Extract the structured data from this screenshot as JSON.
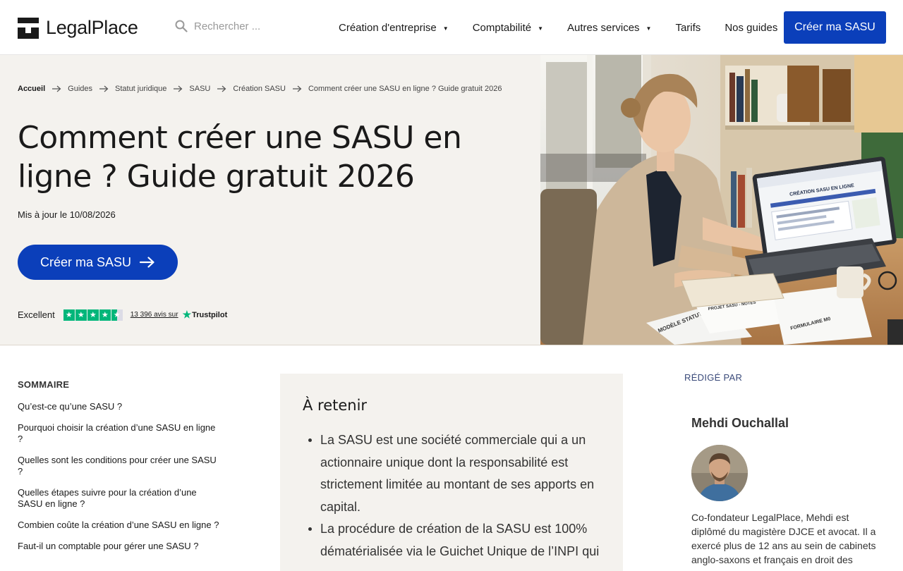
{
  "header": {
    "logo_text": "LegalPlace",
    "search_placeholder": "Rechercher ...",
    "nav": [
      {
        "label": "Création d'entreprise",
        "has_dropdown": true
      },
      {
        "label": "Comptabilité",
        "has_dropdown": true
      },
      {
        "label": "Autres services",
        "has_dropdown": true
      },
      {
        "label": "Tarifs",
        "has_dropdown": false
      },
      {
        "label": "Nos guides",
        "has_dropdown": true
      }
    ],
    "cta_label": "Créer ma SASU"
  },
  "hero": {
    "breadcrumb": [
      "Accueil",
      "Guides",
      "Statut juridique",
      "SASU",
      "Création SASU",
      "Comment créer une SASU en ligne ? Guide gratuit 2026"
    ],
    "title": "Comment créer une SASU en ligne ? Guide gratuit 2026",
    "updated": "Mis à jour le 10/08/2026",
    "cta_label": "Créer ma SASU",
    "trust": {
      "rating_label": "Excellent",
      "stars": 4.5,
      "reviews_text": "13 396 avis sur",
      "brand": "Trustpilot"
    },
    "photo_laptop_text": "CRÉATION SASU EN LIGNE",
    "photo_doc_texts": [
      "MODÈLE STATUTS",
      "PROJET SASU - NOTES",
      "FORMULAIRE M0"
    ]
  },
  "toc": {
    "title": "SOMMAIRE",
    "items": [
      "Qu’est-ce qu’une SASU ?",
      "Pourquoi choisir la création d’une SASU en ligne ?",
      "Quelles sont les conditions pour créer une SASU ?",
      "Quelles étapes suivre pour la création d’une SASU en ligne ?",
      "Combien coûte la création d’une SASU en ligne ?",
      "Faut-il un comptable pour gérer une SASU ?"
    ]
  },
  "keypoints": {
    "title": "À retenir",
    "items": [
      "La SASU est une société commerciale qui a un actionnaire unique dont la responsabilité est strictement limitée au montant de ses apports en capital.",
      "La procédure de création de la SASU est 100% dématérialisée via le Guichet Unique de l’INPI qui"
    ]
  },
  "author": {
    "written_by": "RÉDIGÉ PAR",
    "name": "Mehdi Ouchallal",
    "bio": "Co-fondateur LegalPlace, Mehdi est diplômé du magistère DJCE et avocat. Il a exercé plus de 12 ans au sein de cabinets anglo-saxons et français en droit des"
  },
  "colors": {
    "brand_blue": "#0b3fba",
    "hero_bg": "#f4f2ee",
    "trustpilot_green": "#00b67a"
  }
}
